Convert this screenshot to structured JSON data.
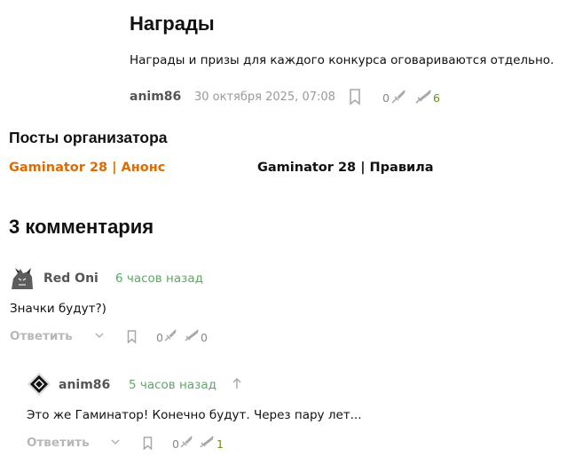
{
  "section": {
    "title": "Награды",
    "body": "Награды и призы для каждого конкурса оговариваются отдельно.",
    "author": "anim86",
    "date": "30 октября 2025, 07:08",
    "dislikes": "0",
    "likes": "6",
    "colors": {
      "accent_orange": "#e06b00",
      "like_green": "#6b8e23",
      "muted": "#9a9a9a"
    }
  },
  "organizer_posts": {
    "heading": "Посты организатора",
    "link_1": "Gaminator 28 | Анонс",
    "link_2": "Gaminator 28 | Правила"
  },
  "comments": {
    "heading": "3 комментария",
    "items": [
      {
        "author": "Red Oni",
        "time": "6 часов назад",
        "text": "Значки будут?)",
        "reply_label": "Ответить",
        "dislikes": "0",
        "likes": "0"
      },
      {
        "author": "anim86",
        "time": "5 часов назад",
        "text": "Это же Гаминатор! Конечно будут. Через пару лет...",
        "reply_label": "Ответить",
        "dislikes": "0",
        "likes": "1"
      }
    ]
  },
  "icons": {
    "bookmark": "bookmark-icon",
    "dislike": "broken-sword-icon",
    "like": "sword-icon",
    "collapse": "chevron-down-icon",
    "parent": "arrow-up-icon"
  }
}
